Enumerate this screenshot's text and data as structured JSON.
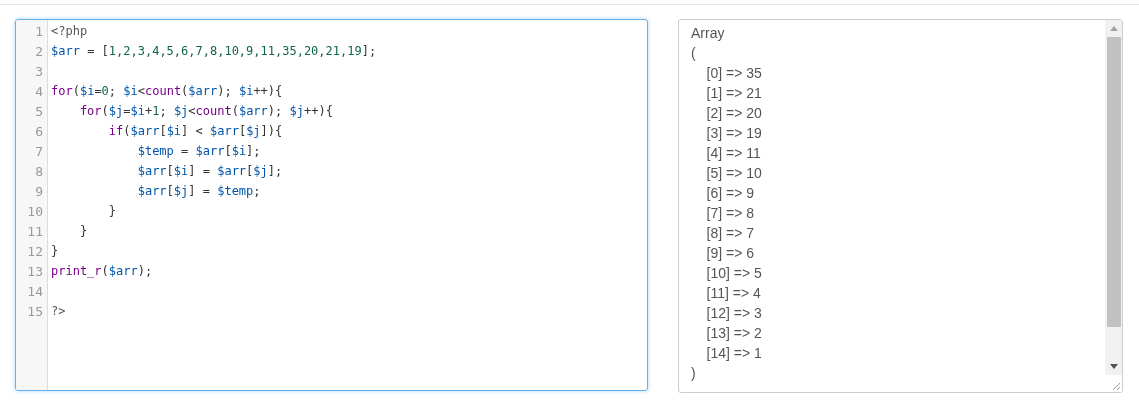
{
  "editor": {
    "lines": [
      {
        "number": "1",
        "tokens": [
          {
            "kind": "meta",
            "text": "<?php"
          }
        ]
      },
      {
        "number": "2",
        "tokens": [
          {
            "kind": "variable",
            "text": "$arr"
          },
          {
            "kind": "plain",
            "text": " = ["
          },
          {
            "kind": "number",
            "text": "1,2,3,4,5,6,7,8,10,9,11,35,20,21,19"
          },
          {
            "kind": "plain",
            "text": "];"
          }
        ]
      },
      {
        "number": "3"
      },
      {
        "number": "4",
        "tokens": [
          {
            "kind": "keyword",
            "text": "for"
          },
          {
            "kind": "plain",
            "text": "("
          },
          {
            "kind": "variable",
            "text": "$i"
          },
          {
            "kind": "plain",
            "text": "="
          },
          {
            "kind": "number",
            "text": "0"
          },
          {
            "kind": "plain",
            "text": "; "
          },
          {
            "kind": "variable",
            "text": "$i"
          },
          {
            "kind": "plain",
            "text": "<"
          },
          {
            "kind": "keyword",
            "text": "count"
          },
          {
            "kind": "plain",
            "text": "("
          },
          {
            "kind": "variable",
            "text": "$arr"
          },
          {
            "kind": "plain",
            "text": "); "
          },
          {
            "kind": "variable",
            "text": "$i"
          },
          {
            "kind": "plain",
            "text": "++){"
          }
        ]
      },
      {
        "number": "5",
        "tokens": [
          {
            "kind": "keyword",
            "text": "    for"
          },
          {
            "kind": "plain",
            "text": "("
          },
          {
            "kind": "variable",
            "text": "$j"
          },
          {
            "kind": "plain",
            "text": "="
          },
          {
            "kind": "variable",
            "text": "$i"
          },
          {
            "kind": "plain",
            "text": "+"
          },
          {
            "kind": "number",
            "text": "1"
          },
          {
            "kind": "plain",
            "text": "; "
          },
          {
            "kind": "variable",
            "text": "$j"
          },
          {
            "kind": "plain",
            "text": "<"
          },
          {
            "kind": "keyword",
            "text": "count"
          },
          {
            "kind": "plain",
            "text": "("
          },
          {
            "kind": "variable",
            "text": "$arr"
          },
          {
            "kind": "plain",
            "text": "); "
          },
          {
            "kind": "variable",
            "text": "$j"
          },
          {
            "kind": "plain",
            "text": "++){"
          }
        ]
      },
      {
        "number": "6",
        "tokens": [
          {
            "kind": "keyword",
            "text": "        if"
          },
          {
            "kind": "plain",
            "text": "("
          },
          {
            "kind": "variable",
            "text": "$arr"
          },
          {
            "kind": "plain",
            "text": "["
          },
          {
            "kind": "variable",
            "text": "$i"
          },
          {
            "kind": "plain",
            "text": "] < "
          },
          {
            "kind": "variable",
            "text": "$arr"
          },
          {
            "kind": "plain",
            "text": "["
          },
          {
            "kind": "variable",
            "text": "$j"
          },
          {
            "kind": "plain",
            "text": "]){"
          }
        ]
      },
      {
        "number": "7",
        "tokens": [
          {
            "kind": "variable",
            "text": "            $temp"
          },
          {
            "kind": "plain",
            "text": " = "
          },
          {
            "kind": "variable",
            "text": "$arr"
          },
          {
            "kind": "plain",
            "text": "["
          },
          {
            "kind": "variable",
            "text": "$i"
          },
          {
            "kind": "plain",
            "text": "];"
          }
        ]
      },
      {
        "number": "8",
        "tokens": [
          {
            "kind": "variable",
            "text": "            $arr"
          },
          {
            "kind": "plain",
            "text": "["
          },
          {
            "kind": "variable",
            "text": "$i"
          },
          {
            "kind": "plain",
            "text": "] = "
          },
          {
            "kind": "variable",
            "text": "$arr"
          },
          {
            "kind": "plain",
            "text": "["
          },
          {
            "kind": "variable",
            "text": "$j"
          },
          {
            "kind": "plain",
            "text": "];"
          }
        ]
      },
      {
        "number": "9",
        "tokens": [
          {
            "kind": "variable",
            "text": "            $arr"
          },
          {
            "kind": "plain",
            "text": "["
          },
          {
            "kind": "variable",
            "text": "$j"
          },
          {
            "kind": "plain",
            "text": "] = "
          },
          {
            "kind": "variable",
            "text": "$temp"
          },
          {
            "kind": "plain",
            "text": ";"
          }
        ]
      },
      {
        "number": "10",
        "tokens": [
          {
            "kind": "plain",
            "text": "        }"
          }
        ]
      },
      {
        "number": "11",
        "tokens": [
          {
            "kind": "plain",
            "text": "    }"
          }
        ]
      },
      {
        "number": "12",
        "tokens": [
          {
            "kind": "plain",
            "text": "}"
          }
        ]
      },
      {
        "number": "13",
        "tokens": [
          {
            "kind": "keyword",
            "text": "print_r"
          },
          {
            "kind": "plain",
            "text": "("
          },
          {
            "kind": "variable",
            "text": "$arr"
          },
          {
            "kind": "plain",
            "text": ");"
          }
        ]
      },
      {
        "number": "14"
      },
      {
        "number": "15",
        "tokens": [
          {
            "kind": "meta",
            "text": "?>"
          }
        ]
      }
    ]
  },
  "output": {
    "lines": [
      "Array",
      "(",
      "    [0] => 35",
      "    [1] => 21",
      "    [2] => 20",
      "    [3] => 19",
      "    [4] => 11",
      "    [5] => 10",
      "    [6] => 9",
      "    [7] => 8",
      "    [8] => 7",
      "    [9] => 6",
      "    [10] => 5",
      "    [11] => 4",
      "    [12] => 3",
      "    [13] => 2",
      "    [14] => 1",
      ")"
    ]
  }
}
